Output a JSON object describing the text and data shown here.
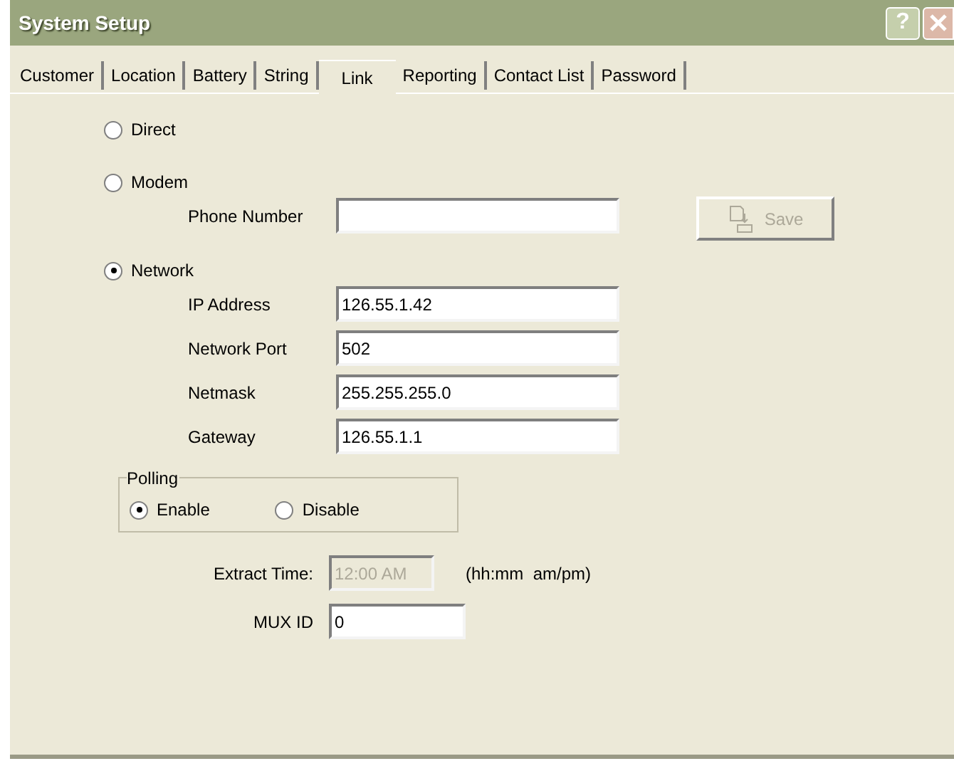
{
  "window": {
    "title": "System Setup",
    "help": "?"
  },
  "tabs": [
    {
      "label": "Customer",
      "selected": false
    },
    {
      "label": "Location",
      "selected": false
    },
    {
      "label": "Battery",
      "selected": false
    },
    {
      "label": "String",
      "selected": false
    },
    {
      "label": "Link",
      "selected": true
    },
    {
      "label": "Reporting",
      "selected": false
    },
    {
      "label": "Contact List",
      "selected": false
    },
    {
      "label": "Password",
      "selected": false
    }
  ],
  "connection": [
    {
      "label": "Direct",
      "selected": false
    },
    {
      "label": "Modem",
      "selected": false,
      "fields": [
        {
          "label": "Phone Number"
        }
      ]
    },
    {
      "label": "Network",
      "selected": true,
      "fields": [
        {
          "label": "IP Address",
          "value": "126.55.1.42"
        },
        {
          "label": "Network Port",
          "value": "502"
        },
        {
          "label": "Netmask",
          "value": "255.255.255.0"
        },
        {
          "label": "Gateway",
          "value": "126.55.1.1"
        }
      ]
    }
  ],
  "save_button": {
    "label": "Save",
    "disabled": true
  },
  "polling": {
    "title": "Polling",
    "options": [
      {
        "label": "Enable",
        "selected": true
      },
      {
        "label": "Disable",
        "selected": false
      }
    ]
  },
  "extract_time": {
    "label": "Extract Time:",
    "value": "12:00 AM",
    "disabled": true,
    "hint": "(hh:mm  am/pm)"
  },
  "mux_id": {
    "label": "MUX ID",
    "value": "0"
  }
}
